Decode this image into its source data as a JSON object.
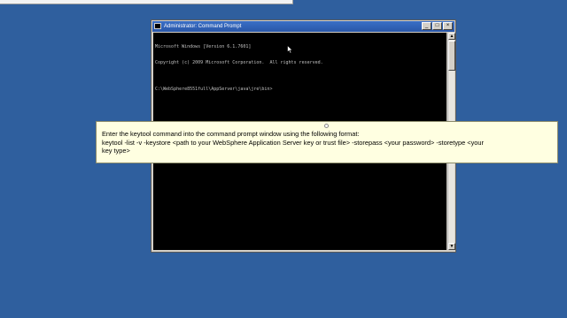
{
  "window": {
    "title": "Administrator: Command Prompt",
    "buttons": {
      "minimize": "_",
      "maximize": "□",
      "close": "×"
    }
  },
  "console": {
    "lines": [
      "Microsoft Windows [Version 6.1.7601]",
      "Copyright (c) 2009 Microsoft Corporation.  All rights reserved.",
      "",
      "C:\\WebSphere8551full\\AppServer\\java\\jre\\bin>"
    ]
  },
  "scrollbar": {
    "up": "▲",
    "down": "▼"
  },
  "callout": {
    "line1": "Enter the keytool command into the command prompt window using the following format:",
    "line2": "keytool -list -v -keystore <path to your WebSphere Application Server key or trust file> -storepass <your password> -storetype <your",
    "line3": "key type>"
  },
  "colors": {
    "desktop": "#2f5f9e",
    "console_bg": "#000000",
    "console_text": "#c0c0c0",
    "callout_bg": "#ffffe1"
  }
}
